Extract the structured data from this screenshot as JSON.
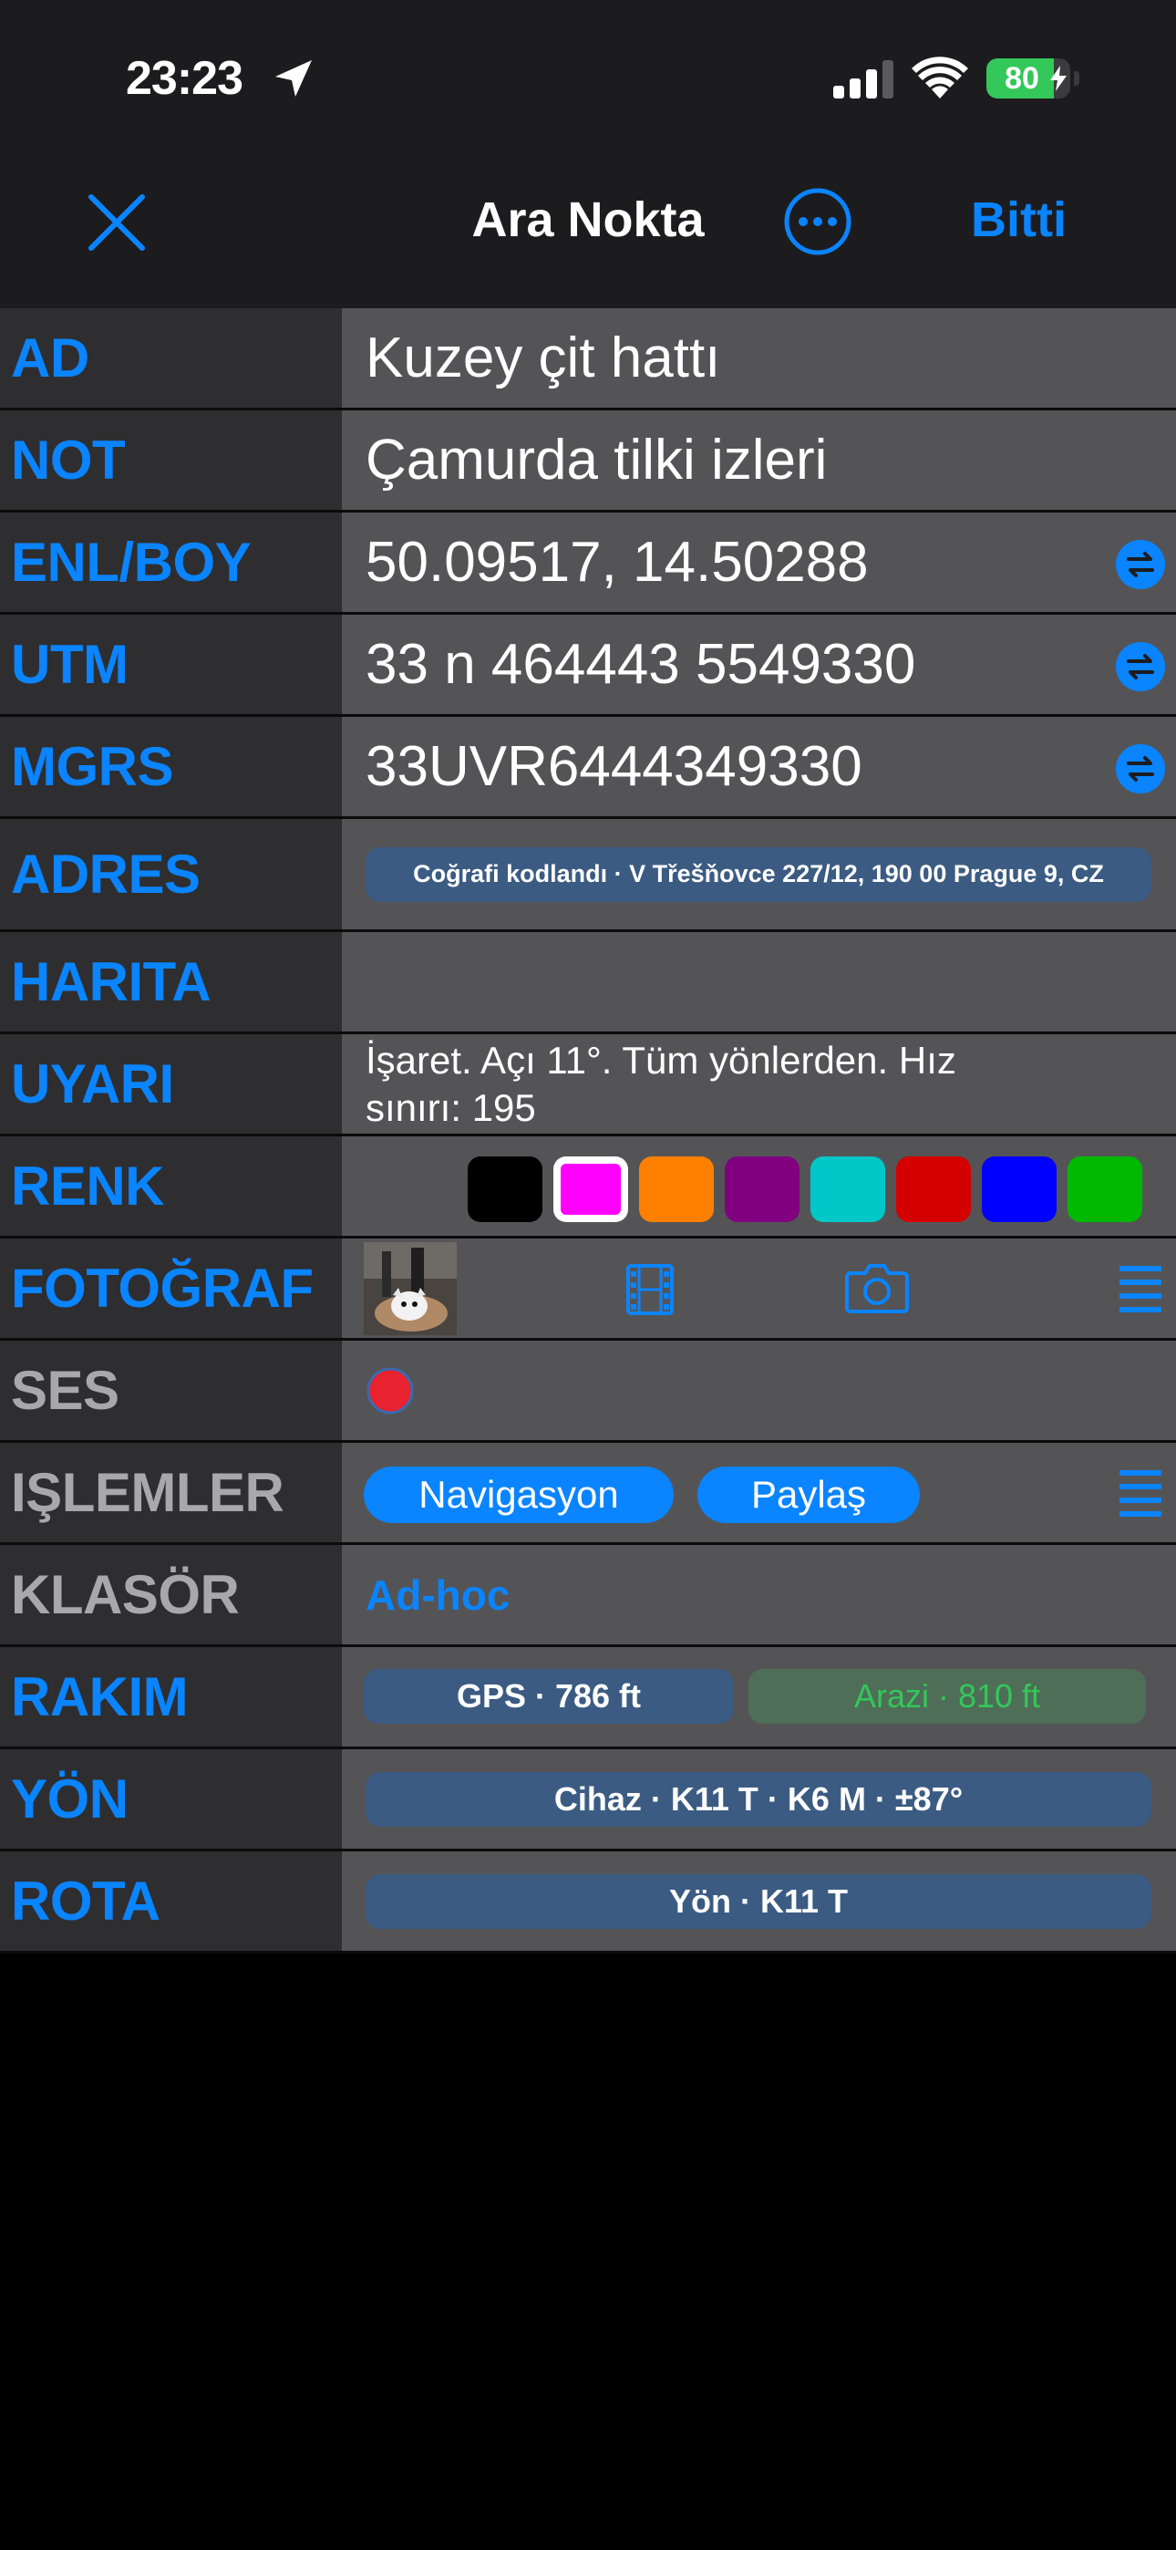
{
  "status_bar": {
    "time": "23:23",
    "battery": "80",
    "battery_level": 0.8
  },
  "nav": {
    "title": "Ara Nokta",
    "done_label": "Bitti",
    "close_icon": "close-icon",
    "more_icon": "ellipsis-circle-icon"
  },
  "rows": {
    "ad": {
      "label": "AD",
      "value": "Kuzey çit hattı"
    },
    "not": {
      "label": "NOT",
      "value": "Çamurda tilki izleri"
    },
    "enlboy": {
      "label": "ENL/BOY",
      "value": "50.09517, 14.50288"
    },
    "utm": {
      "label": "UTM",
      "value": "33 n 464443 5549330"
    },
    "mgrs": {
      "label": "MGRS",
      "value": "33UVR6444349330"
    },
    "adres": {
      "label": "ADRES",
      "value": "Coğrafi kodlandı · V Třešňovce 227/12, 190 00 Prague 9, CZ"
    },
    "harita": {
      "label": "HARITA"
    },
    "uyari": {
      "label": "UYARI",
      "line1": "İşaret. Açı 11°.  Tüm yönlerden. Hız",
      "line2": "sınırı: 195"
    },
    "renk": {
      "label": "RENK",
      "colors": [
        "#000000",
        "#ff00ff",
        "#ff8000",
        "#800080",
        "#00c8c8",
        "#d40000",
        "#0000ff",
        "#00b800"
      ],
      "selected": 1
    },
    "fotograf": {
      "label": "FOTOĞRAF"
    },
    "ses": {
      "label": "SES"
    },
    "islemler": {
      "label": "IŞLEMLER",
      "nav_button": "Navigasyon",
      "share_button": "Paylaş"
    },
    "klasor": {
      "label": "KLASÖR",
      "value": "Ad-hoc"
    },
    "rakim": {
      "label": "RAKIM",
      "gps": "GPS · 786 ft",
      "arazi": "Arazi · 810 ft"
    },
    "yon": {
      "label": "YÖN",
      "value": "Cihaz · K11 T · K6 M · ±87°"
    },
    "rota": {
      "label": "ROTA",
      "value": "Yön · K11 T"
    }
  }
}
